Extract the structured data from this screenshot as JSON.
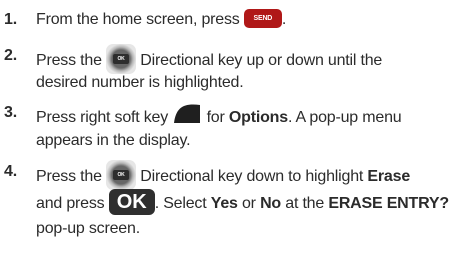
{
  "steps": [
    {
      "number": "1.",
      "lines": [
        {
          "pre": "From the home screen, press",
          "key": "SEND",
          "post": "."
        }
      ]
    },
    {
      "number": "2.",
      "lines": [
        {
          "pre": "Press the",
          "key": "OK",
          "post": "Directional key up or down until the"
        },
        {
          "text": "desired number is highlighted."
        }
      ]
    },
    {
      "number": "3.",
      "lines": [
        {
          "pre": "Press right soft key",
          "post_a": "for",
          "bold": "Options",
          "post_b": ". A pop-up menu"
        },
        {
          "text": "appears in the display."
        }
      ]
    },
    {
      "number": "4.",
      "lines": [
        {
          "pre": "Press the",
          "key": "OK",
          "post_a": "Directional key down to highlight",
          "bold": "Erase"
        },
        {
          "pre": "and press",
          "key": "OK",
          "post_a": ". Select",
          "bold_a": "Yes",
          "mid": "or",
          "bold_b": "No",
          "post_b": "at the",
          "bold_c": "ERASE ENTRY?"
        },
        {
          "text": "pop-up screen."
        }
      ]
    }
  ]
}
